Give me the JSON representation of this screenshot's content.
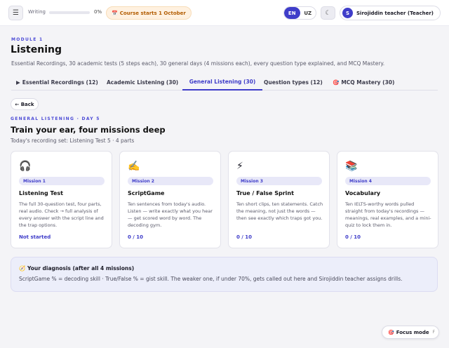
{
  "topbar": {
    "menu_icon": "hamburger-icon",
    "writing_label": "Writing",
    "writing_progress_fraction": 0,
    "writing_pct": "0%",
    "course_pill": {
      "icon": "calendar-icon",
      "icon_glyph": "📅",
      "text": "Course starts 1 October"
    },
    "lang": {
      "en": "EN",
      "uz": "UZ",
      "active": "EN"
    },
    "theme_icon": "moon-icon",
    "theme_glyph": "☾",
    "user": {
      "initial": "S",
      "name": "Sirojiddin teacher (Teacher)"
    }
  },
  "module": {
    "label": "MODULE 1",
    "title": "Listening",
    "subtitle": "Essential Recordings, 30 academic tests (5 steps each), 30 general days (4 missions each), every question type explained, and MCQ Mastery."
  },
  "tabs": [
    {
      "icon_glyph": "▶",
      "label": "Essential Recordings (12)"
    },
    {
      "icon_glyph": "",
      "label": "Academic Listening (30)"
    },
    {
      "icon_glyph": "",
      "label": "General Listening (30)",
      "active": true
    },
    {
      "icon_glyph": "",
      "label": "Question types (12)"
    },
    {
      "icon_glyph": "🎯",
      "label": "MCQ Mastery (30)"
    }
  ],
  "back_label": "← Back",
  "day": {
    "label": "GENERAL LISTENING · DAY 5",
    "title": "Train your ear, four missions deep",
    "set": "Today's recording set: Listening Test 5 · 4 parts"
  },
  "missions": [
    {
      "icon": "headphones-icon",
      "glyph": "🎧",
      "badge": "Mission 1",
      "title": "Listening Test",
      "desc": "The full 30-question test, four parts, real audio. Check → full analysis of every answer with the script line and the trap options.",
      "status": "Not started"
    },
    {
      "icon": "writing-hand-icon",
      "glyph": "✍️",
      "badge": "Mission 2",
      "title": "ScriptGame",
      "desc": "Ten sentences from today's audio. Listen — write exactly what you hear — get scored word by word. The decoding gym.",
      "status": "0 / 10"
    },
    {
      "icon": "lightning-icon",
      "glyph": "⚡",
      "badge": "Mission 3",
      "title": "True / False Sprint",
      "desc": "Ten short clips, ten statements. Catch the meaning, not just the words — then see exactly which traps got you.",
      "status": "0 / 10"
    },
    {
      "icon": "books-icon",
      "glyph": "📚",
      "badge": "Mission 4",
      "title": "Vocabulary",
      "desc": "Ten IELTS-worthy words pulled straight from today's recordings — meanings, real examples, and a mini-quiz to lock them in.",
      "status": "0 / 10"
    }
  ],
  "diagnosis": {
    "icon": "compass-icon",
    "glyph": "🧭",
    "title": "Your diagnosis (after all 4 missions)",
    "text": "ScriptGame % = decoding skill · True/False % = gist skill. The weaker one, if under 70%, gets called out here and Sirojiddin teacher assigns drills."
  },
  "focus": {
    "icon": "target-icon",
    "glyph": "🎯",
    "label": "Focus mode",
    "key": "F"
  },
  "colors": {
    "accent": "#3f3dc9",
    "course_pill_text": "#b25c00",
    "diagnosis_bg": "#eceefa"
  }
}
